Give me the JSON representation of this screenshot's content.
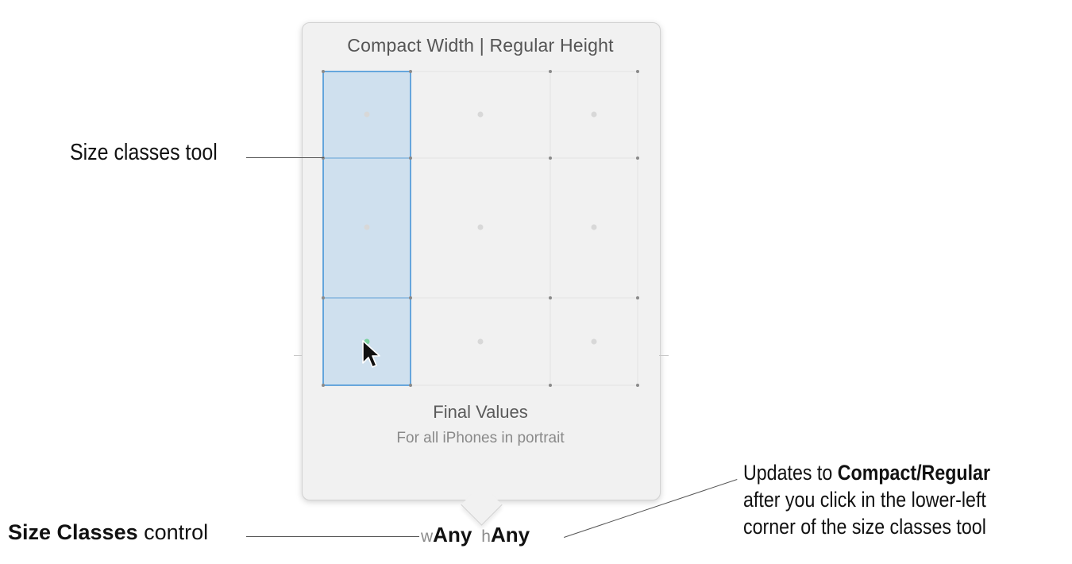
{
  "popover": {
    "title": "Compact Width | Regular Height",
    "final_title": "Final Values",
    "final_subtitle": "For all iPhones in portrait"
  },
  "size_classes_control": {
    "width_prefix": "w",
    "width_value": "Any",
    "height_prefix": "h",
    "height_value": "Any"
  },
  "callouts": {
    "tool_label": "Size classes tool",
    "control_label_bold": "Size Classes",
    "control_label_rest": " control",
    "updates_line1_a": "Updates to ",
    "updates_line1_b": "Compact/Regular",
    "updates_line2": "after you click in the lower-left",
    "updates_line3": "corner of the size classes tool"
  },
  "colors": {
    "selection_fill": "#cfe0ee",
    "selection_border": "#3d8fd6",
    "popover_bg": "#f1f1f1"
  }
}
